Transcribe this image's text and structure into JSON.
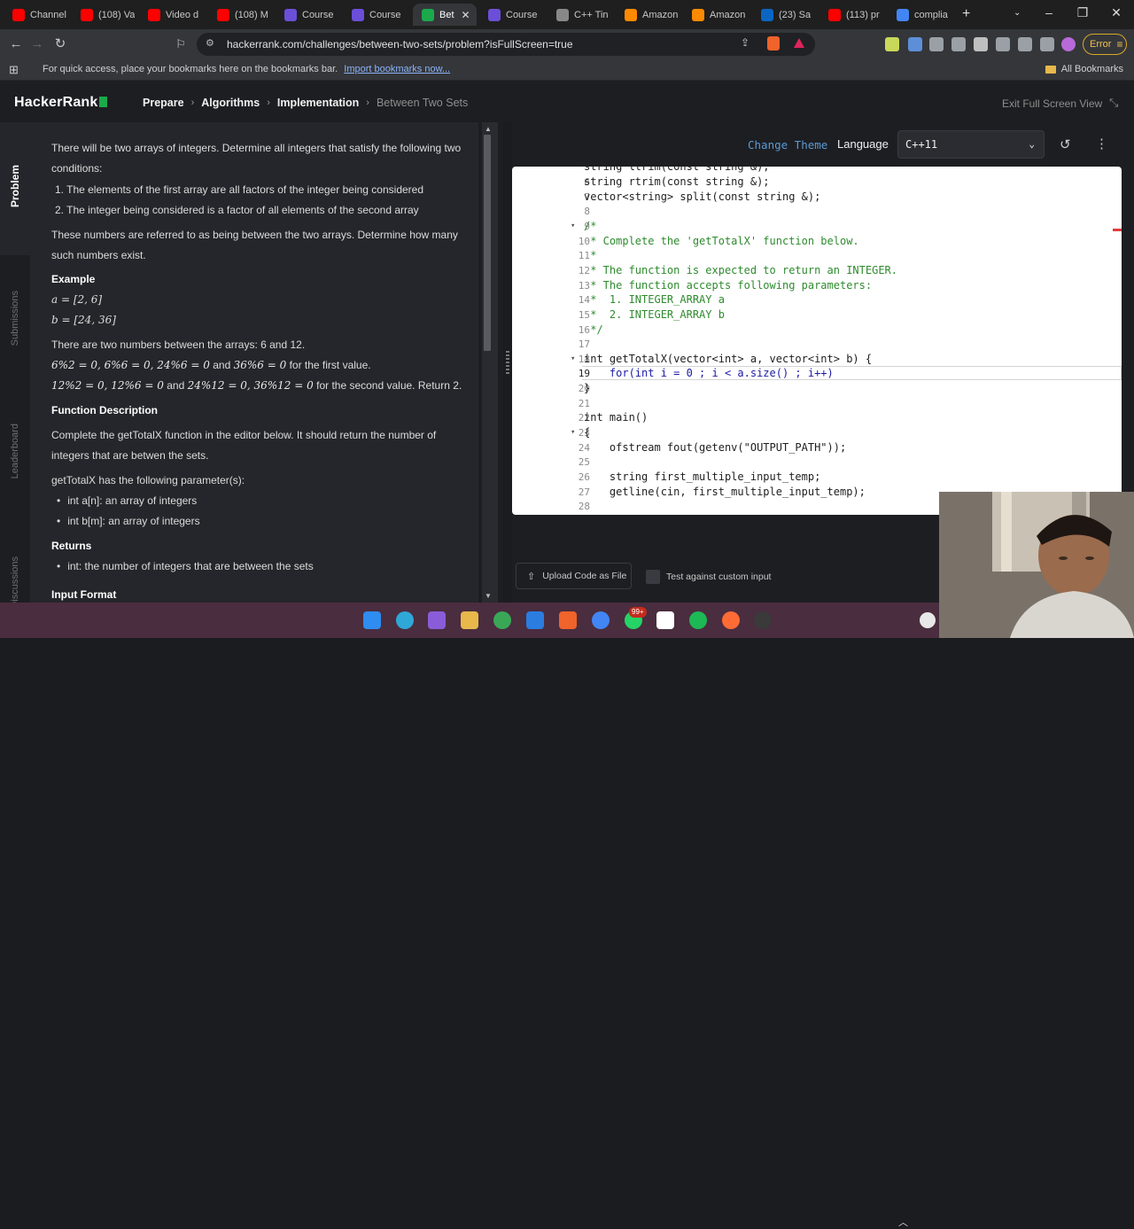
{
  "browser": {
    "tabs": [
      {
        "title": "Channel",
        "icon": "youtube-icon",
        "color": "#ff0000"
      },
      {
        "title": "(108) Va",
        "icon": "youtube-icon",
        "color": "#ff0000"
      },
      {
        "title": "Video d",
        "icon": "youtube-icon",
        "color": "#ff0000"
      },
      {
        "title": "(108) M",
        "icon": "youtube-icon",
        "color": "#ff0000"
      },
      {
        "title": "Course",
        "icon": "course-icon",
        "color": "#6b4fd8"
      },
      {
        "title": "Course",
        "icon": "course-icon",
        "color": "#6b4fd8"
      },
      {
        "title": "Bet",
        "icon": "hackerrank-icon",
        "color": "#1ba94c"
      },
      {
        "title": "Course",
        "icon": "course-icon",
        "color": "#6b4fd8"
      },
      {
        "title": "C++ Tin",
        "icon": "globe-icon",
        "color": "#888888"
      },
      {
        "title": "Amazon",
        "icon": "amazon-icon",
        "color": "#ff8a00"
      },
      {
        "title": "Amazon",
        "icon": "amazon-icon",
        "color": "#ff8a00"
      },
      {
        "title": "(23) Sa",
        "icon": "linkedin-icon",
        "color": "#0a66c2"
      },
      {
        "title": "(113) pr",
        "icon": "youtube-icon",
        "color": "#ff0000"
      },
      {
        "title": "complia",
        "icon": "google-icon",
        "color": "#4285f4"
      }
    ],
    "url": "hackerrank.com/challenges/between-two-sets/problem?isFullScreen=true",
    "error_label": "Error",
    "bookmarks_msg": "For quick access, place your bookmarks here on the bookmarks bar.",
    "bookmarks_link": "Import bookmarks now...",
    "all_bookmarks": "All Bookmarks"
  },
  "header": {
    "logo": "HackerRank",
    "breadcrumbs": [
      "Prepare",
      "Algorithms",
      "Implementation",
      "Between Two Sets"
    ],
    "exit_fullscreen": "Exit Full Screen View"
  },
  "side_tabs": [
    "Problem",
    "Submissions",
    "Leaderboard",
    "Discussions"
  ],
  "problem": {
    "intro_1": "There will be two arrays of integers. Determine all integers that satisfy the following two",
    "intro_2": "conditions:",
    "cond_1": "1. The elements of the first array are all factors of the integer being considered",
    "cond_2": "2. The integer being considered is a factor of all elements of the second array",
    "para_1": "These numbers are referred to as being between the two arrays. Determine how many",
    "para_2": "such numbers exist.",
    "example_h": "Example",
    "ex_a": "a = [2, 6]",
    "ex_b": "b = [24, 36]",
    "ex_line1": "There are two numbers between the arrays: 6 and 12.",
    "ex_line2_math": "6%2 = 0, 6%6 = 0, 24%6 = 0",
    "ex_line2_and": "and",
    "ex_line2_math2": "36%6 = 0",
    "ex_line2_tail": "for the first value.",
    "ex_line3_math": "12%2 = 0, 12%6 = 0",
    "ex_line3_and": "and",
    "ex_line3_math2": "24%12 = 0, 36%12 = 0",
    "ex_line3_tail": "for the second value. Return 2.",
    "funcdesc_h": "Function Description",
    "funcdesc_1": "Complete the getTotalX function in the editor below. It should return the number of",
    "funcdesc_2": "integers that are betwen the sets.",
    "params_intro": "getTotalX has the following parameter(s):",
    "param_a": "int a[n]: an array of integers",
    "param_b": "int b[m]: an array of integers",
    "returns_h": "Returns",
    "returns_1": "int: the number of integers that are between the sets",
    "input_h": "Input Format"
  },
  "editor": {
    "change_theme": "Change Theme",
    "language_label": "Language",
    "language_value": "C++11",
    "lines": [
      {
        "n": "6",
        "html": "string rtrim(const string &);"
      },
      {
        "n": "7",
        "html": "vector<string> split(const string &);"
      },
      {
        "n": "8",
        "html": ""
      },
      {
        "n": "9",
        "html": "/*"
      },
      {
        "n": "10",
        "html": " * Complete the 'getTotalX' function below."
      },
      {
        "n": "11",
        "html": " *"
      },
      {
        "n": "12",
        "html": " * The function is expected to return an INTEGER."
      },
      {
        "n": "13",
        "html": " * The function accepts following parameters:"
      },
      {
        "n": "14",
        "html": " *  1. INTEGER_ARRAY a"
      },
      {
        "n": "15",
        "html": " *  2. INTEGER_ARRAY b"
      },
      {
        "n": "16",
        "html": " */"
      },
      {
        "n": "17",
        "html": ""
      },
      {
        "n": "18",
        "html": "int getTotalX(vector<int> a, vector<int> b) {"
      },
      {
        "n": "19",
        "html": "    for(int i = 0 ; i < a.size() ; i++)"
      },
      {
        "n": "20",
        "html": "}"
      },
      {
        "n": "21",
        "html": ""
      },
      {
        "n": "22",
        "html": "int main()"
      },
      {
        "n": "23",
        "html": "{"
      },
      {
        "n": "24",
        "html": "    ofstream fout(getenv(\"OUTPUT_PATH\"));"
      },
      {
        "n": "25",
        "html": ""
      },
      {
        "n": "26",
        "html": "    string first_multiple_input_temp;"
      },
      {
        "n": "27",
        "html": "    getline(cin, first_multiple_input_temp);"
      },
      {
        "n": "28",
        "html": ""
      }
    ],
    "upload_label": "Upload Code as File",
    "custom_input_label": "Test against custom input"
  },
  "taskbar": {
    "badge": "99+"
  }
}
